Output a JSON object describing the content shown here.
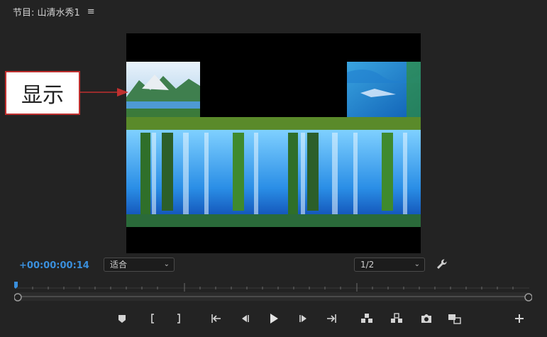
{
  "panel": {
    "title": "节目: 山清水秀1",
    "menu_icon": "hamburger-menu-icon"
  },
  "callout": {
    "label": "显示",
    "border_color": "#c0302f"
  },
  "timecode": "+00:00:00:14",
  "zoom_select": {
    "value": "适合"
  },
  "resolution_select": {
    "value": "1/2"
  },
  "colors": {
    "accent": "#3a8fdc",
    "panel_bg": "#232323",
    "monitor_bg": "#000000"
  },
  "transport": {
    "buttons": [
      "add-marker-icon",
      "mark-in-icon",
      "mark-out-icon",
      "go-to-in-icon",
      "step-back-icon",
      "play-icon",
      "step-forward-icon",
      "go-to-out-icon",
      "lift-icon",
      "extract-icon",
      "export-frame-icon",
      "comparison-view-icon",
      "button-editor-plus-icon"
    ]
  }
}
